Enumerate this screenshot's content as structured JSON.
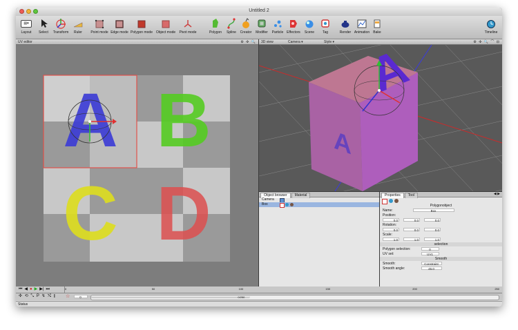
{
  "window": {
    "title": "Untitled 2"
  },
  "colors": {
    "accent_red": "#e0524a",
    "blue": "#4444dd",
    "green": "#55cc33",
    "yellow": "#dddd22",
    "red_letter": "#dd5555"
  },
  "toolbar": {
    "layout": "Layout",
    "select": "Select",
    "transform": "Transform",
    "ruler": "Ruler",
    "point_mode": "Point mode",
    "edge_mode": "Edge mode",
    "polygon_mode": "Polygon mode",
    "object_mode": "Object mode",
    "pivot_mode": "Pivot mode",
    "polygon": "Polygon",
    "spline": "Spline",
    "creator": "Creator",
    "modifier": "Modifier",
    "particle": "Particle",
    "effectors": "Effectors",
    "scene": "Scene",
    "tag": "Tag",
    "render": "Render",
    "animation": "Animation",
    "bake": "Bake",
    "timeline": "Timeline"
  },
  "uv_editor": {
    "title": "UV editor",
    "letters": [
      "A",
      "B",
      "C",
      "D"
    ]
  },
  "view3d": {
    "title": "3D view",
    "camera": "Camera",
    "style": "Style",
    "letter": "A"
  },
  "object_browser": {
    "tabs": [
      "Object browser",
      "Material"
    ],
    "items": [
      {
        "name": "Camera"
      },
      {
        "name": "Box"
      }
    ]
  },
  "properties": {
    "tabs": [
      "Properties",
      "Tool"
    ],
    "object_type": "Polygonobject",
    "name_label": "Name:",
    "name_value": "Box",
    "position_label": "Position:",
    "position": [
      "0.0",
      "0.0",
      "0.0"
    ],
    "rotation_label": "Rotation:",
    "rotation": [
      "0.0",
      "0.0",
      "0.0"
    ],
    "scale_label": "Scale:",
    "scale": [
      "1.0",
      "1.0",
      "1.0"
    ],
    "section_selection": "selection",
    "polygon_selection_label": "Polygon selection:",
    "polygon_selection_value": "0",
    "uv_set_label": "UV set:",
    "uv_set_value": "UV1",
    "section_smooth": "Smooth",
    "smooth_label": "Smooth:",
    "smooth_value": "Constraint",
    "smooth_angle_label": "Smooth angle:",
    "smooth_angle_value": "45.0"
  },
  "timeline": {
    "ruler_labels": [
      "0",
      "50",
      "100",
      "150",
      "200",
      "250"
    ],
    "frame_value": "0",
    "scrub_label": "0/250",
    "status": "Status"
  }
}
